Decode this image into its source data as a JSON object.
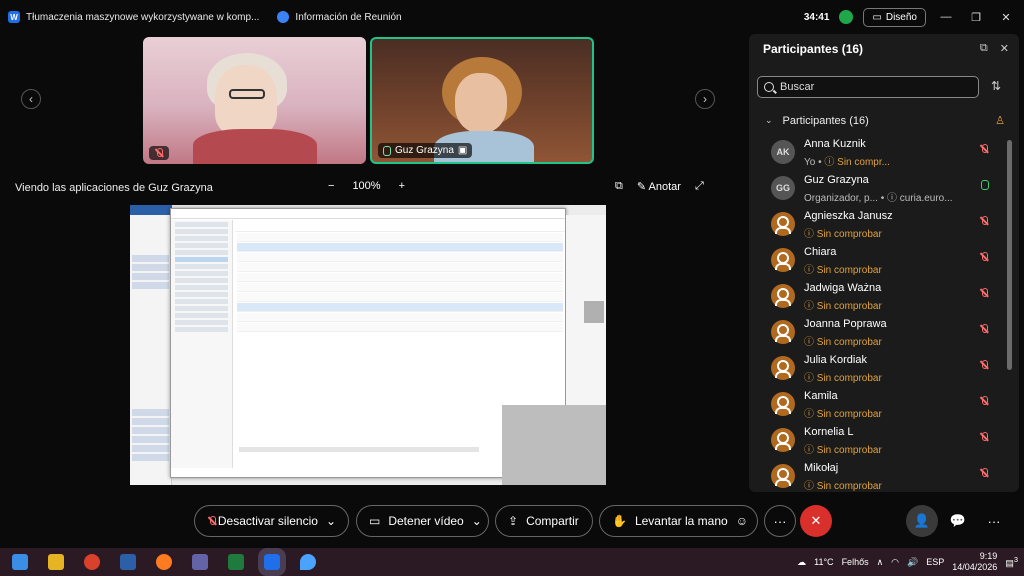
{
  "titlebar": {
    "app_title": "Tłumaczenia maszynowe wykorzystywane w komp...",
    "meeting_title": "Información de Reunión",
    "timer": "34:41",
    "layout_label": "Diseño"
  },
  "videos": [
    {
      "name": ""
    },
    {
      "name": "Guz Grazyna"
    }
  ],
  "share": {
    "title": "Viendo las aplicaciones de Guz Grazyna",
    "zoom_minus": "−",
    "zoom": "100%",
    "zoom_plus": "+",
    "annotate_label": "Anotar"
  },
  "panel": {
    "title": "Participantes (16)",
    "search_placeholder": "Buscar",
    "section_label": "Participantes (16)",
    "participants": [
      {
        "initials": "AK",
        "name": "Anna Kuznik",
        "sub_gray": "Yo •",
        "sub": "Sin compr...",
        "mic": "off"
      },
      {
        "initials": "GG",
        "name": "Guz Grazyna",
        "sub_gray": "Organizador, p...  •  ⓘ curia.euro...",
        "sub": "",
        "mic": "on"
      },
      {
        "initials": "",
        "name": "Agnieszka Janusz",
        "sub_gray": "",
        "sub": "Sin comprobar",
        "mic": "off"
      },
      {
        "initials": "",
        "name": "Chiara",
        "sub_gray": "",
        "sub": "Sin comprobar",
        "mic": "off"
      },
      {
        "initials": "",
        "name": "Jadwiga Ważna",
        "sub_gray": "",
        "sub": "Sin comprobar",
        "mic": "off"
      },
      {
        "initials": "",
        "name": "Joanna Poprawa",
        "sub_gray": "",
        "sub": "Sin comprobar",
        "mic": "off"
      },
      {
        "initials": "",
        "name": "Julia Kordiak",
        "sub_gray": "",
        "sub": "Sin comprobar",
        "mic": "off"
      },
      {
        "initials": "",
        "name": "Kamila",
        "sub_gray": "",
        "sub": "Sin comprobar",
        "mic": "off"
      },
      {
        "initials": "",
        "name": "Kornelia L",
        "sub_gray": "",
        "sub": "Sin comprobar",
        "mic": "off"
      },
      {
        "initials": "",
        "name": "Mikołaj",
        "sub_gray": "",
        "sub": "Sin comprobar",
        "mic": "off"
      }
    ]
  },
  "controls": {
    "mute_label": "Desactivar silencio",
    "video_label": "Detener vídeo",
    "share_label": "Compartir",
    "hand_label": "Levantar la mano",
    "more": "···"
  },
  "taskbar": {
    "weather_temp": "11°C",
    "weather_place": "Felhős",
    "lang": "ESP",
    "time": "9:19",
    "date": "14/04/2026",
    "notif_count": "3"
  },
  "colors": {
    "accent_green": "#1ec48a",
    "warning_orange": "#e0a23a",
    "end_red": "#d9302c"
  }
}
